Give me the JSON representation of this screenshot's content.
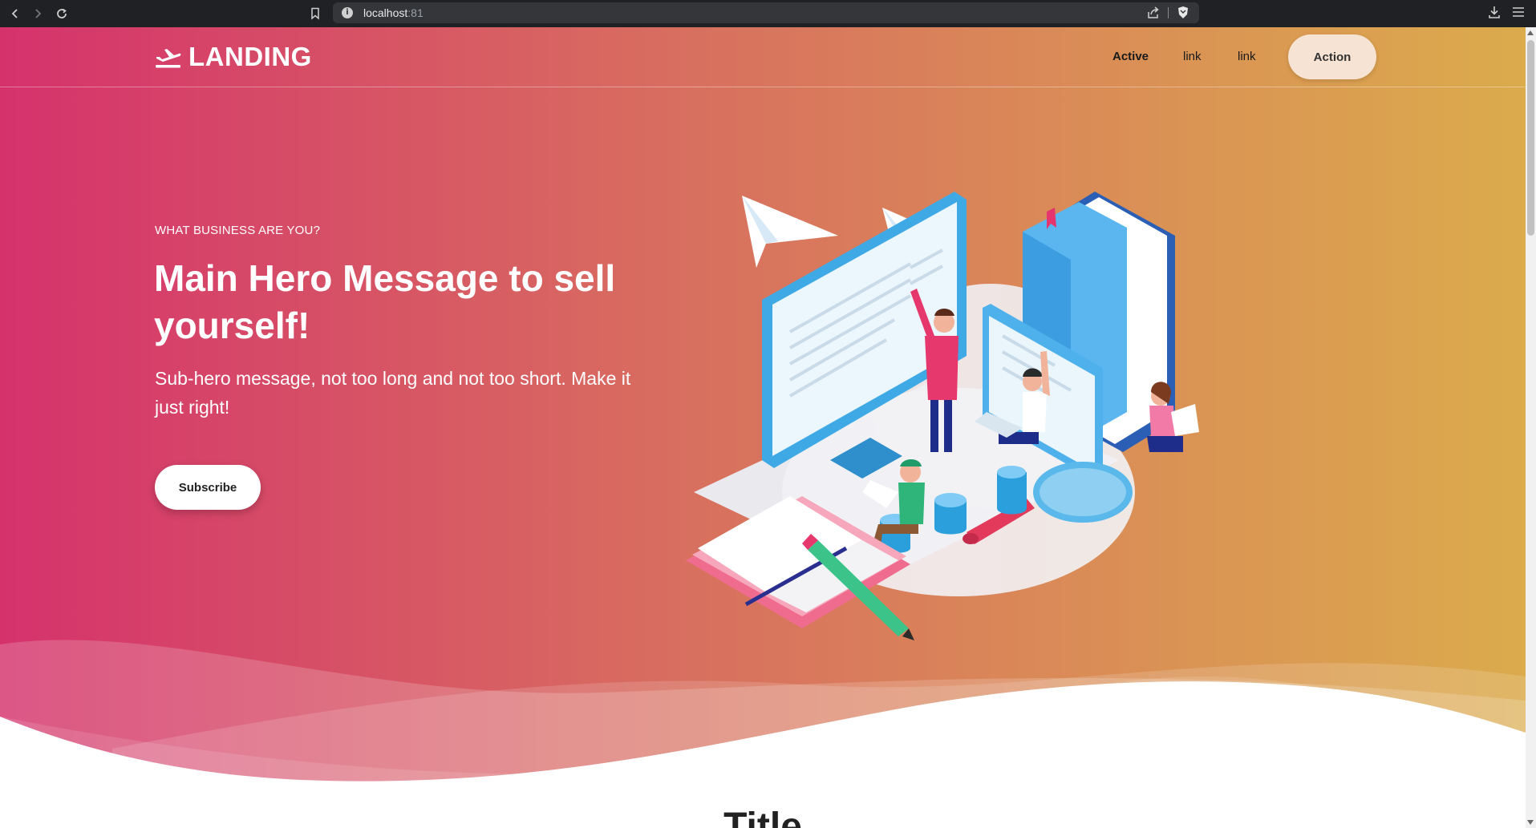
{
  "browser": {
    "url_host": "localhost",
    "url_port": ":81"
  },
  "nav": {
    "brand": "LANDING",
    "links": [
      {
        "label": "Active",
        "active": true
      },
      {
        "label": "link",
        "active": false
      },
      {
        "label": "link",
        "active": false
      }
    ],
    "action_label": "Action"
  },
  "hero": {
    "eyebrow": "WHAT BUSINESS ARE YOU?",
    "title": "Main Hero Message to sell yourself!",
    "subtitle": "Sub-hero message, not too long and not too short. Make it just right!",
    "cta_label": "Subscribe"
  },
  "section": {
    "title": "Title"
  },
  "colors": {
    "gradient_start": "#d5326c",
    "gradient_end": "#dbab4c",
    "action_bg": "#f6e3d3"
  }
}
